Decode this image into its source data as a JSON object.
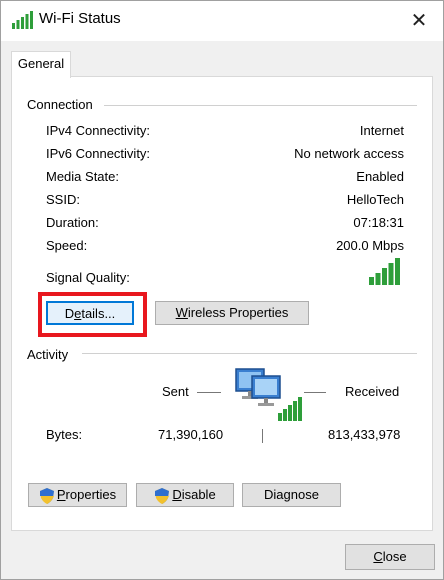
{
  "window": {
    "title": "Wi-Fi Status",
    "close_glyph": "✕"
  },
  "tabs": [
    {
      "label": "General"
    }
  ],
  "connection": {
    "heading": "Connection",
    "rows": [
      {
        "label": "IPv4 Connectivity:",
        "value": "Internet"
      },
      {
        "label": "IPv6 Connectivity:",
        "value": "No network access"
      },
      {
        "label": "Media State:",
        "value": "Enabled"
      },
      {
        "label": "SSID:",
        "value": "HelloTech"
      },
      {
        "label": "Duration:",
        "value": "07:18:31"
      },
      {
        "label": "Speed:",
        "value": "200.0 Mbps"
      }
    ],
    "signal_label": "Signal Quality:",
    "signal_bars_filled": 5,
    "signal_bars_total": 5
  },
  "buttons": {
    "details_pre": "D",
    "details_ul": "e",
    "details_post": "tails...",
    "wireless_ul": "W",
    "wireless_post": "ireless Properties"
  },
  "activity": {
    "heading": "Activity",
    "sent_label": "Sent",
    "received_label": "Received",
    "bytes_label": "Bytes:",
    "bytes_sent": "71,390,160",
    "bytes_received": "813,433,978"
  },
  "actions": {
    "properties_ul": "P",
    "properties_post": "roperties",
    "disable_ul": "D",
    "disable_post": "isable",
    "diagnose_label": "Diagnose"
  },
  "footer": {
    "close_ul": "C",
    "close_post": "lose"
  },
  "colors": {
    "highlight": "#e8171e",
    "signal_green": "#2e9e3a",
    "focus_blue": "#0078d7"
  }
}
